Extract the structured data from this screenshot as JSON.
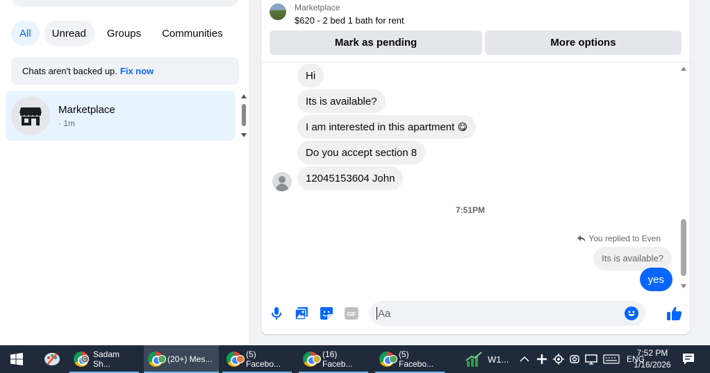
{
  "sidebar": {
    "filters": [
      {
        "label": "All",
        "active": true
      },
      {
        "label": "Unread",
        "active": false
      },
      {
        "label": "Groups",
        "active": false
      },
      {
        "label": "Communities",
        "active": false
      }
    ],
    "backup_notice": {
      "text": "Chats aren't backed up.",
      "link": "Fix now"
    },
    "chats": [
      {
        "name": "Marketplace",
        "time": "· 1m"
      }
    ]
  },
  "listing": {
    "category": "Marketplace",
    "title": "$620 - 2 bed 1 bath for rent",
    "mark_pending_label": "Mark as pending",
    "more_options_label": "More options"
  },
  "conversation": {
    "incoming": [
      {
        "text": "Hi"
      },
      {
        "text": "Its is available?"
      },
      {
        "text": "I am interested in this apartment",
        "emoji": "😋"
      },
      {
        "text": "Do you accept section 8"
      },
      {
        "text": "12045153604 John"
      }
    ],
    "timestamp": "7:51PM",
    "reply_note": "You replied to Even",
    "quoted_text": "Its is available?",
    "outgoing": [
      {
        "text": "yes"
      }
    ]
  },
  "composer": {
    "placeholder": "Aa",
    "icons": [
      "microphone-icon",
      "photo-icon",
      "sticker-icon",
      "gif-icon",
      "emoji-icon",
      "thumbs-up-icon"
    ]
  },
  "taskbar": {
    "items": [
      {
        "label": "Sadam Sh...",
        "badge": "C",
        "active": false
      },
      {
        "label": "(20+) Mes...",
        "badge": "",
        "active": true
      },
      {
        "label": "(5) Facebo...",
        "badge": "",
        "active": false
      },
      {
        "label": "(16) Faceb...",
        "badge": "",
        "active": false
      },
      {
        "label": "(5) Facebo...",
        "badge": "",
        "active": false
      },
      {
        "label": "W1...",
        "badge": "",
        "active": false
      }
    ],
    "language": "ENG",
    "time": "7:52 PM",
    "date": "1/16/2026"
  },
  "colors": {
    "accent": "#0866ff",
    "bubble_incoming": "#f0f0f0",
    "selected_chat": "#e7f3ff",
    "taskbar": "#1f2a3a"
  }
}
